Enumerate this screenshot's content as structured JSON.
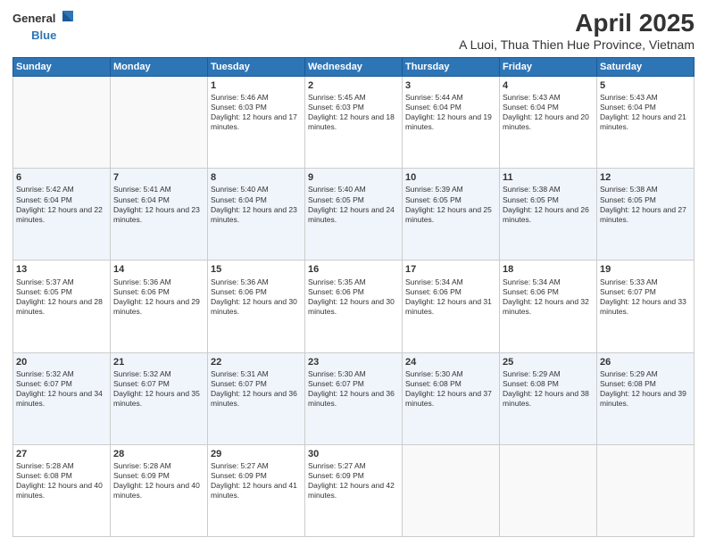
{
  "logo": {
    "line1": "General",
    "line2": "Blue"
  },
  "title": "April 2025",
  "subtitle": "A Luoi, Thua Thien Hue Province, Vietnam",
  "days_of_week": [
    "Sunday",
    "Monday",
    "Tuesday",
    "Wednesday",
    "Thursday",
    "Friday",
    "Saturday"
  ],
  "weeks": [
    [
      {
        "day": "",
        "sunrise": "",
        "sunset": "",
        "daylight": ""
      },
      {
        "day": "",
        "sunrise": "",
        "sunset": "",
        "daylight": ""
      },
      {
        "day": "1",
        "sunrise": "Sunrise: 5:46 AM",
        "sunset": "Sunset: 6:03 PM",
        "daylight": "Daylight: 12 hours and 17 minutes."
      },
      {
        "day": "2",
        "sunrise": "Sunrise: 5:45 AM",
        "sunset": "Sunset: 6:03 PM",
        "daylight": "Daylight: 12 hours and 18 minutes."
      },
      {
        "day": "3",
        "sunrise": "Sunrise: 5:44 AM",
        "sunset": "Sunset: 6:04 PM",
        "daylight": "Daylight: 12 hours and 19 minutes."
      },
      {
        "day": "4",
        "sunrise": "Sunrise: 5:43 AM",
        "sunset": "Sunset: 6:04 PM",
        "daylight": "Daylight: 12 hours and 20 minutes."
      },
      {
        "day": "5",
        "sunrise": "Sunrise: 5:43 AM",
        "sunset": "Sunset: 6:04 PM",
        "daylight": "Daylight: 12 hours and 21 minutes."
      }
    ],
    [
      {
        "day": "6",
        "sunrise": "Sunrise: 5:42 AM",
        "sunset": "Sunset: 6:04 PM",
        "daylight": "Daylight: 12 hours and 22 minutes."
      },
      {
        "day": "7",
        "sunrise": "Sunrise: 5:41 AM",
        "sunset": "Sunset: 6:04 PM",
        "daylight": "Daylight: 12 hours and 23 minutes."
      },
      {
        "day": "8",
        "sunrise": "Sunrise: 5:40 AM",
        "sunset": "Sunset: 6:04 PM",
        "daylight": "Daylight: 12 hours and 23 minutes."
      },
      {
        "day": "9",
        "sunrise": "Sunrise: 5:40 AM",
        "sunset": "Sunset: 6:05 PM",
        "daylight": "Daylight: 12 hours and 24 minutes."
      },
      {
        "day": "10",
        "sunrise": "Sunrise: 5:39 AM",
        "sunset": "Sunset: 6:05 PM",
        "daylight": "Daylight: 12 hours and 25 minutes."
      },
      {
        "day": "11",
        "sunrise": "Sunrise: 5:38 AM",
        "sunset": "Sunset: 6:05 PM",
        "daylight": "Daylight: 12 hours and 26 minutes."
      },
      {
        "day": "12",
        "sunrise": "Sunrise: 5:38 AM",
        "sunset": "Sunset: 6:05 PM",
        "daylight": "Daylight: 12 hours and 27 minutes."
      }
    ],
    [
      {
        "day": "13",
        "sunrise": "Sunrise: 5:37 AM",
        "sunset": "Sunset: 6:05 PM",
        "daylight": "Daylight: 12 hours and 28 minutes."
      },
      {
        "day": "14",
        "sunrise": "Sunrise: 5:36 AM",
        "sunset": "Sunset: 6:06 PM",
        "daylight": "Daylight: 12 hours and 29 minutes."
      },
      {
        "day": "15",
        "sunrise": "Sunrise: 5:36 AM",
        "sunset": "Sunset: 6:06 PM",
        "daylight": "Daylight: 12 hours and 30 minutes."
      },
      {
        "day": "16",
        "sunrise": "Sunrise: 5:35 AM",
        "sunset": "Sunset: 6:06 PM",
        "daylight": "Daylight: 12 hours and 30 minutes."
      },
      {
        "day": "17",
        "sunrise": "Sunrise: 5:34 AM",
        "sunset": "Sunset: 6:06 PM",
        "daylight": "Daylight: 12 hours and 31 minutes."
      },
      {
        "day": "18",
        "sunrise": "Sunrise: 5:34 AM",
        "sunset": "Sunset: 6:06 PM",
        "daylight": "Daylight: 12 hours and 32 minutes."
      },
      {
        "day": "19",
        "sunrise": "Sunrise: 5:33 AM",
        "sunset": "Sunset: 6:07 PM",
        "daylight": "Daylight: 12 hours and 33 minutes."
      }
    ],
    [
      {
        "day": "20",
        "sunrise": "Sunrise: 5:32 AM",
        "sunset": "Sunset: 6:07 PM",
        "daylight": "Daylight: 12 hours and 34 minutes."
      },
      {
        "day": "21",
        "sunrise": "Sunrise: 5:32 AM",
        "sunset": "Sunset: 6:07 PM",
        "daylight": "Daylight: 12 hours and 35 minutes."
      },
      {
        "day": "22",
        "sunrise": "Sunrise: 5:31 AM",
        "sunset": "Sunset: 6:07 PM",
        "daylight": "Daylight: 12 hours and 36 minutes."
      },
      {
        "day": "23",
        "sunrise": "Sunrise: 5:30 AM",
        "sunset": "Sunset: 6:07 PM",
        "daylight": "Daylight: 12 hours and 36 minutes."
      },
      {
        "day": "24",
        "sunrise": "Sunrise: 5:30 AM",
        "sunset": "Sunset: 6:08 PM",
        "daylight": "Daylight: 12 hours and 37 minutes."
      },
      {
        "day": "25",
        "sunrise": "Sunrise: 5:29 AM",
        "sunset": "Sunset: 6:08 PM",
        "daylight": "Daylight: 12 hours and 38 minutes."
      },
      {
        "day": "26",
        "sunrise": "Sunrise: 5:29 AM",
        "sunset": "Sunset: 6:08 PM",
        "daylight": "Daylight: 12 hours and 39 minutes."
      }
    ],
    [
      {
        "day": "27",
        "sunrise": "Sunrise: 5:28 AM",
        "sunset": "Sunset: 6:08 PM",
        "daylight": "Daylight: 12 hours and 40 minutes."
      },
      {
        "day": "28",
        "sunrise": "Sunrise: 5:28 AM",
        "sunset": "Sunset: 6:09 PM",
        "daylight": "Daylight: 12 hours and 40 minutes."
      },
      {
        "day": "29",
        "sunrise": "Sunrise: 5:27 AM",
        "sunset": "Sunset: 6:09 PM",
        "daylight": "Daylight: 12 hours and 41 minutes."
      },
      {
        "day": "30",
        "sunrise": "Sunrise: 5:27 AM",
        "sunset": "Sunset: 6:09 PM",
        "daylight": "Daylight: 12 hours and 42 minutes."
      },
      {
        "day": "",
        "sunrise": "",
        "sunset": "",
        "daylight": ""
      },
      {
        "day": "",
        "sunrise": "",
        "sunset": "",
        "daylight": ""
      },
      {
        "day": "",
        "sunrise": "",
        "sunset": "",
        "daylight": ""
      }
    ]
  ]
}
